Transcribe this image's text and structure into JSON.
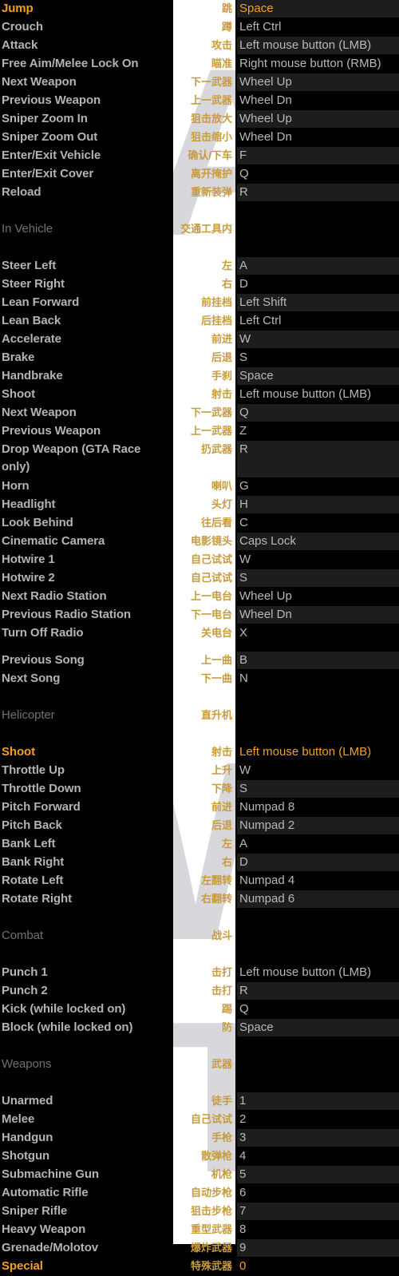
{
  "meta": {
    "title": "GTA Keyboard Controls Reference",
    "accent_color": "#f0a21e",
    "chinese_color": "#c89b3c",
    "label_color": "#b3b3b3",
    "section_color": "#707070",
    "value_color": "#b8b8b8",
    "background": "#000000",
    "strip_background": "#ffffff",
    "watermark_color": "#d8d8dc"
  },
  "watermark": {
    "glyph_a": "A",
    "glyph_w": "W",
    "glyph_t": "T"
  },
  "rows": [
    {
      "type": "row",
      "label": "Jump",
      "cn": "跳",
      "key": "Space",
      "highlight": true,
      "shade": true
    },
    {
      "type": "row",
      "label": "Crouch",
      "cn": "蹲",
      "key": "Left Ctrl",
      "highlight": false,
      "shade": false
    },
    {
      "type": "row",
      "label": "Attack",
      "cn": "攻击",
      "key": "Left mouse button (LMB)",
      "highlight": false,
      "shade": true
    },
    {
      "type": "row",
      "label": "Free Aim/Melee Lock On",
      "cn": "瞄准",
      "key": "Right mouse button (RMB)",
      "highlight": false,
      "shade": false
    },
    {
      "type": "row",
      "label": "Next Weapon",
      "cn": "下一武器",
      "key": "Wheel Up",
      "highlight": false,
      "shade": true
    },
    {
      "type": "row",
      "label": "Previous Weapon",
      "cn": "上一武器",
      "key": "Wheel Dn",
      "highlight": false,
      "shade": false
    },
    {
      "type": "row",
      "label": "Sniper Zoom In",
      "cn": "狙击放大",
      "key": "Wheel Up",
      "highlight": false,
      "shade": true
    },
    {
      "type": "row",
      "label": "Sniper Zoom Out",
      "cn": "狙击缩小",
      "key": "Wheel Dn",
      "highlight": false,
      "shade": false
    },
    {
      "type": "row",
      "label": "Enter/Exit Vehicle",
      "cn": "确认/下车",
      "key": "F",
      "highlight": false,
      "shade": true
    },
    {
      "type": "row",
      "label": "Enter/Exit Cover",
      "cn": "离开掩护",
      "key": "Q",
      "highlight": false,
      "shade": false
    },
    {
      "type": "row",
      "label": "Reload",
      "cn": "重新装弹",
      "key": "R",
      "highlight": false,
      "shade": true
    },
    {
      "type": "spacer"
    },
    {
      "type": "section",
      "label": "In Vehicle",
      "cn": "交通工具内",
      "key": ""
    },
    {
      "type": "spacer"
    },
    {
      "type": "row",
      "label": "Steer Left",
      "cn": "左",
      "key": "A",
      "highlight": false,
      "shade": true
    },
    {
      "type": "row",
      "label": "Steer Right",
      "cn": "右",
      "key": "D",
      "highlight": false,
      "shade": false
    },
    {
      "type": "row",
      "label": "Lean Forward",
      "cn": "前挂档",
      "key": "Left Shift",
      "highlight": false,
      "shade": true
    },
    {
      "type": "row",
      "label": "Lean Back",
      "cn": "后挂档",
      "key": "Left Ctrl",
      "highlight": false,
      "shade": false
    },
    {
      "type": "row",
      "label": "Accelerate",
      "cn": "前进",
      "key": "W",
      "highlight": false,
      "shade": true
    },
    {
      "type": "row",
      "label": "Brake",
      "cn": "后退",
      "key": "S",
      "highlight": false,
      "shade": false
    },
    {
      "type": "row",
      "label": "Handbrake",
      "cn": "手刹",
      "key": "Space",
      "highlight": false,
      "shade": true
    },
    {
      "type": "row",
      "label": "Shoot",
      "cn": "射击",
      "key": "Left mouse button (LMB)",
      "highlight": false,
      "shade": false
    },
    {
      "type": "row",
      "label": "Next Weapon",
      "cn": "下一武器",
      "key": "Q",
      "highlight": false,
      "shade": true
    },
    {
      "type": "row",
      "label": "Previous Weapon",
      "cn": "上一武器",
      "key": "Z",
      "highlight": false,
      "shade": false
    },
    {
      "type": "row",
      "label": "Drop Weapon (GTA Race only)",
      "cn": "扔武器",
      "key": "R",
      "highlight": false,
      "shade": true,
      "tall": true
    },
    {
      "type": "row",
      "label": "Horn",
      "cn": "喇叭",
      "key": "G",
      "highlight": false,
      "shade": false
    },
    {
      "type": "row",
      "label": "Headlight",
      "cn": "头灯",
      "key": "H",
      "highlight": false,
      "shade": true
    },
    {
      "type": "row",
      "label": "Look Behind",
      "cn": "往后看",
      "key": "C",
      "highlight": false,
      "shade": false
    },
    {
      "type": "row",
      "label": "Cinematic Camera",
      "cn": "电影镜头",
      "key": "Caps Lock",
      "highlight": false,
      "shade": true
    },
    {
      "type": "row",
      "label": "Hotwire 1",
      "cn": "自己试试",
      "key": "W",
      "highlight": false,
      "shade": false
    },
    {
      "type": "row",
      "label": "Hotwire 2",
      "cn": "自己试试",
      "key": "S",
      "highlight": false,
      "shade": true
    },
    {
      "type": "row",
      "label": "Next Radio Station",
      "cn": "上一电台",
      "key": "Wheel Up",
      "highlight": false,
      "shade": false
    },
    {
      "type": "row",
      "label": "Previous Radio Station",
      "cn": "下一电台",
      "key": "Wheel Dn",
      "highlight": false,
      "shade": true
    },
    {
      "type": "row",
      "label": "Turn Off Radio",
      "cn": "关电台",
      "key": "X",
      "highlight": false,
      "shade": false
    },
    {
      "type": "spacer-sm"
    },
    {
      "type": "row",
      "label": "Previous Song",
      "cn": "上一曲",
      "key": "B",
      "highlight": false,
      "shade": true
    },
    {
      "type": "row",
      "label": "Next Song",
      "cn": "下一曲",
      "key": "N",
      "highlight": false,
      "shade": false
    },
    {
      "type": "spacer"
    },
    {
      "type": "section",
      "label": "Helicopter",
      "cn": "直升机",
      "key": ""
    },
    {
      "type": "spacer"
    },
    {
      "type": "row",
      "label": "Shoot",
      "cn": "射击",
      "key": "Left mouse button (LMB)",
      "highlight": true,
      "shade": false
    },
    {
      "type": "row",
      "label": "Throttle Up",
      "cn": "上升",
      "key": "W",
      "highlight": false,
      "shade": false
    },
    {
      "type": "row",
      "label": "Throttle Down",
      "cn": "下降",
      "key": "S",
      "highlight": false,
      "shade": true
    },
    {
      "type": "row",
      "label": "Pitch Forward",
      "cn": "前进",
      "key": "Numpad 8",
      "highlight": false,
      "shade": false
    },
    {
      "type": "row",
      "label": "Pitch Back",
      "cn": "后退",
      "key": "Numpad 2",
      "highlight": false,
      "shade": true
    },
    {
      "type": "row",
      "label": "Bank Left",
      "cn": "左",
      "key": "A",
      "highlight": false,
      "shade": false
    },
    {
      "type": "row",
      "label": "Bank Right",
      "cn": "右",
      "key": "D",
      "highlight": false,
      "shade": true
    },
    {
      "type": "row",
      "label": "Rotate Left",
      "cn": "左翻转",
      "key": "Numpad 4",
      "highlight": false,
      "shade": false
    },
    {
      "type": "row",
      "label": "Rotate Right",
      "cn": "右翻转",
      "key": "Numpad 6",
      "highlight": false,
      "shade": true
    },
    {
      "type": "spacer"
    },
    {
      "type": "section",
      "label": "Combat",
      "cn": "战斗",
      "key": ""
    },
    {
      "type": "spacer"
    },
    {
      "type": "row",
      "label": "Punch 1",
      "cn": "击打",
      "key": "Left mouse button (LMB)",
      "highlight": false,
      "shade": false
    },
    {
      "type": "row",
      "label": "Punch 2",
      "cn": "击打",
      "key": "R",
      "highlight": false,
      "shade": true
    },
    {
      "type": "row",
      "label": "Kick (while locked on)",
      "cn": "踢",
      "key": "Q",
      "highlight": false,
      "shade": false
    },
    {
      "type": "row",
      "label": "Block (while locked on)",
      "cn": "防",
      "key": "Space",
      "highlight": false,
      "shade": true
    },
    {
      "type": "spacer"
    },
    {
      "type": "section",
      "label": "Weapons",
      "cn": "武器",
      "key": ""
    },
    {
      "type": "spacer"
    },
    {
      "type": "row",
      "label": "Unarmed",
      "cn": "徒手",
      "key": "1",
      "highlight": false,
      "shade": true
    },
    {
      "type": "row",
      "label": "Melee",
      "cn": "自己试试",
      "key": "2",
      "highlight": false,
      "shade": false
    },
    {
      "type": "row",
      "label": "Handgun",
      "cn": "手枪",
      "key": "3",
      "highlight": false,
      "shade": true
    },
    {
      "type": "row",
      "label": "Shotgun",
      "cn": "散弹枪",
      "key": "4",
      "highlight": false,
      "shade": false
    },
    {
      "type": "row",
      "label": "Submachine Gun",
      "cn": "机枪",
      "key": "5",
      "highlight": false,
      "shade": true
    },
    {
      "type": "row",
      "label": "Automatic Rifle",
      "cn": "自动步枪",
      "key": "6",
      "highlight": false,
      "shade": false
    },
    {
      "type": "row",
      "label": "Sniper Rifle",
      "cn": "狙击步枪",
      "key": "7",
      "highlight": false,
      "shade": true
    },
    {
      "type": "row",
      "label": "Heavy Weapon",
      "cn": "重型武器",
      "key": "8",
      "highlight": false,
      "shade": false
    },
    {
      "type": "row",
      "label": "Grenade/Molotov",
      "cn": "爆炸武器",
      "key": "9",
      "highlight": false,
      "shade": true
    },
    {
      "type": "row",
      "label": "Special",
      "cn": "特殊武器",
      "key": "0",
      "highlight": true,
      "shade": false
    }
  ]
}
